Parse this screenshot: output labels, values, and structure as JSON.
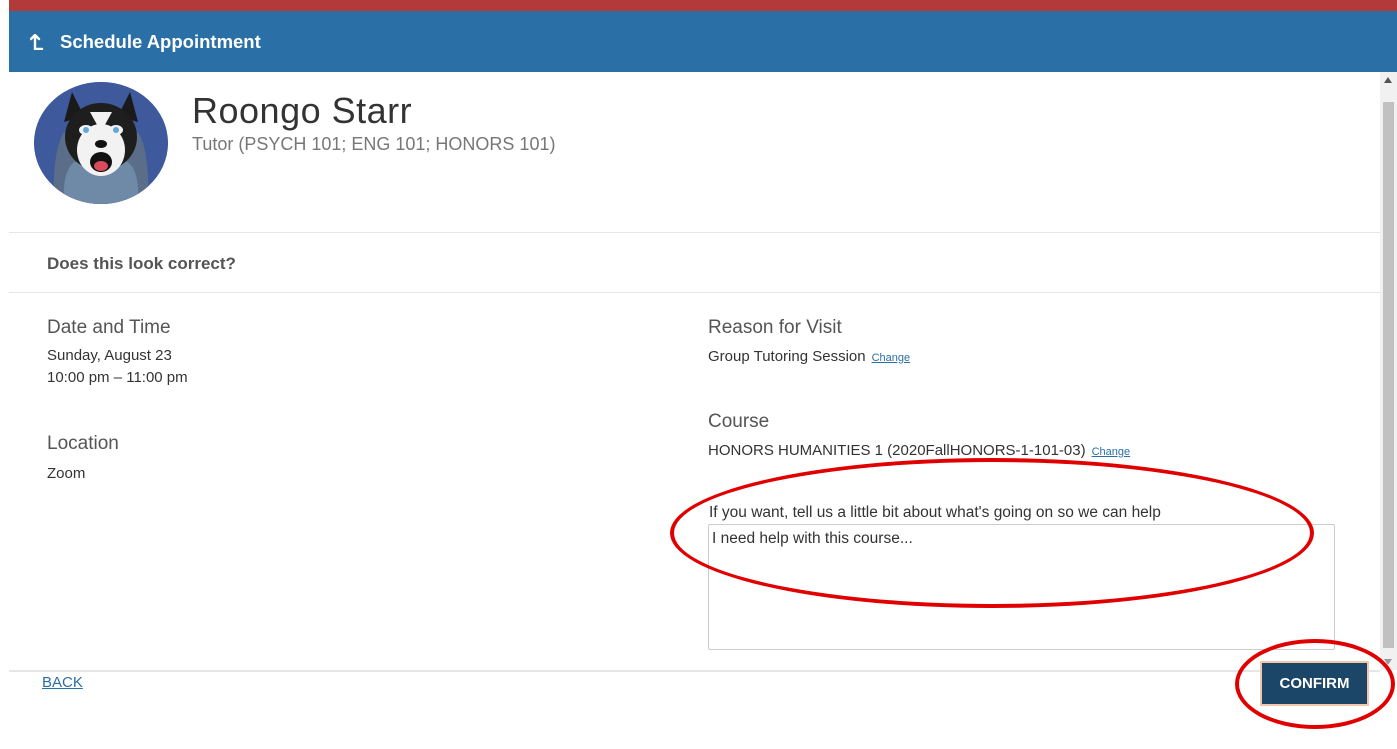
{
  "header": {
    "title": "Schedule Appointment",
    "back_icon": "back-arrow-icon"
  },
  "tutor": {
    "name": "Roongo Starr",
    "role": "Tutor (PSYCH 101; ENG 101; HONORS 101)",
    "avatar_icon": "husky-mascot-avatar"
  },
  "review": {
    "prompt": "Does this look correct?",
    "date_time": {
      "label": "Date and Time",
      "date": "Sunday, August 23",
      "time": "10:00 pm – 11:00 pm"
    },
    "location": {
      "label": "Location",
      "value": "Zoom"
    },
    "reason": {
      "label": "Reason for Visit",
      "value": "Group Tutoring Session",
      "change_label": "Change"
    },
    "course": {
      "label": "Course",
      "value": "HONORS HUMANITIES 1 (2020FallHONORS-1-101-03)",
      "change_label": "Change"
    },
    "notes": {
      "prompt": "If you want, tell us a little bit about what's going on so we can help",
      "value": "I need help with this course..."
    }
  },
  "footer": {
    "back_label": "BACK",
    "confirm_label": "CONFIRM"
  },
  "colors": {
    "header": "#2a6fa5",
    "top_strip": "#b23a3a",
    "confirm": "#1c4668",
    "link": "#2a6fa5",
    "annotation": "#e00000"
  }
}
